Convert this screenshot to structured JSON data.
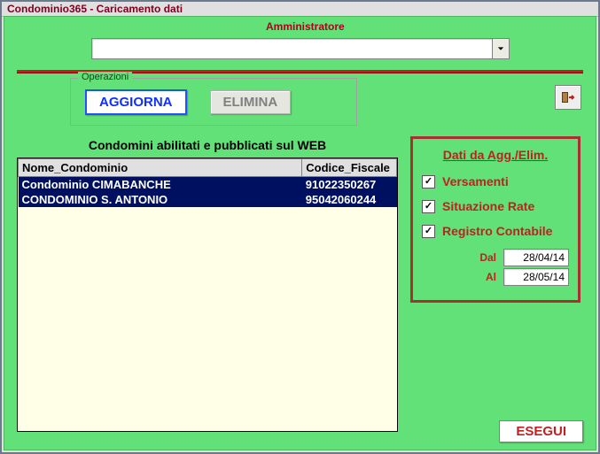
{
  "window": {
    "title": "Condominio365 - Caricamento dati"
  },
  "admin": {
    "label": "Amministratore",
    "value": ""
  },
  "ops": {
    "legend": "Operazioni",
    "aggiorna_label": "AGGIORNA",
    "elimina_label": "ELIMINA"
  },
  "table": {
    "title": "Condomini abilitati e pubblicati sul WEB",
    "headers": {
      "name": "Nome_Condominio",
      "cf": "Codice_Fiscale"
    },
    "rows": [
      {
        "name": "Condominio CIMABANCHE",
        "cf": "91022350267"
      },
      {
        "name": "CONDOMINIO S. ANTONIO",
        "cf": "95042060244"
      }
    ]
  },
  "right": {
    "title": "Dati da Agg./Elim.",
    "versamenti": {
      "label": "Versamenti",
      "checked": true
    },
    "situazione": {
      "label": "Situazione Rate",
      "checked": true
    },
    "registro": {
      "label": "Registro Contabile",
      "checked": true
    },
    "dal": {
      "label": "Dal",
      "value": "28/04/14"
    },
    "al": {
      "label": "Al",
      "value": "28/05/14"
    }
  },
  "footer": {
    "esegui_label": "ESEGUI"
  }
}
